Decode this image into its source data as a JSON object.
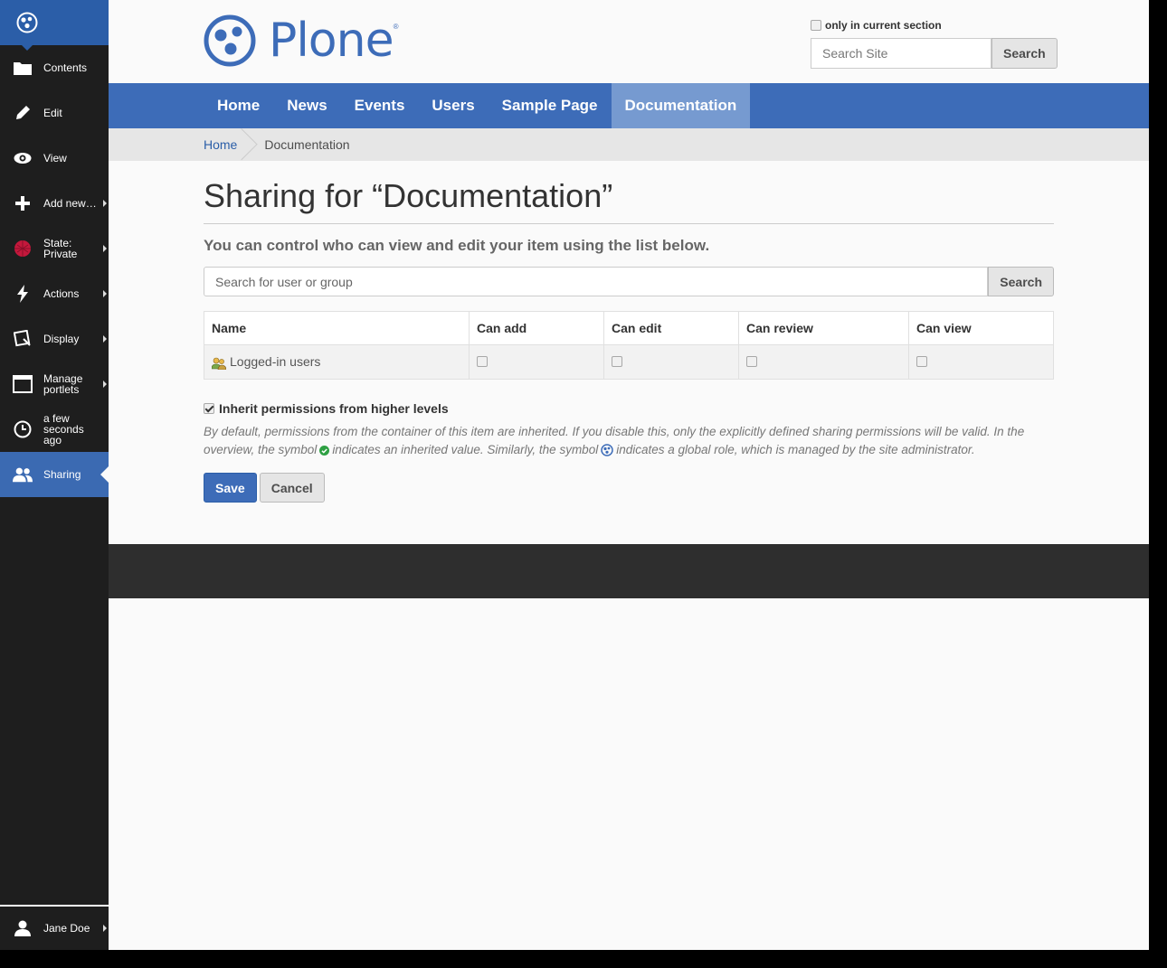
{
  "toolbar": {
    "items": [
      {
        "label": "Contents",
        "icon": "folder-icon"
      },
      {
        "label": "Edit",
        "icon": "pencil-icon"
      },
      {
        "label": "View",
        "icon": "eye-icon"
      },
      {
        "label": "Add new…",
        "icon": "plus-icon"
      },
      {
        "label": "State:\nPrivate",
        "icon": "state-icon"
      },
      {
        "label": "Actions",
        "icon": "lightning-icon"
      },
      {
        "label": "Display",
        "icon": "display-icon"
      },
      {
        "label": "Manage\nportlets",
        "icon": "portlets-icon"
      },
      {
        "label": "a few\nseconds\nago",
        "icon": "clock-icon"
      },
      {
        "label": "Sharing",
        "icon": "users-icon"
      }
    ],
    "user": "Jane Doe"
  },
  "header": {
    "logo_text": "Plone",
    "logo_reg": "®",
    "only_current_section": "only in current section",
    "search_placeholder": "Search Site",
    "search_button": "Search"
  },
  "nav": {
    "items": [
      "Home",
      "News",
      "Events",
      "Users",
      "Sample Page",
      "Documentation"
    ]
  },
  "breadcrumb": {
    "home": "Home",
    "current": "Documentation"
  },
  "page": {
    "title": "Sharing for “Documentation”",
    "lead": "You can control who can view and edit your item using the list below.",
    "user_search_placeholder": "Search for user or group",
    "user_search_button": "Search",
    "table": {
      "headers": [
        "Name",
        "Can add",
        "Can edit",
        "Can review",
        "Can view"
      ],
      "rows": [
        {
          "name": "Logged-in users"
        }
      ]
    },
    "inherit_label": "Inherit permissions from higher levels",
    "help_part1": "By default, permissions from the container of this item are inherited. If you disable this, only the explicitly defined sharing permissions will be valid. In the overview, the symbol",
    "help_part2": "indicates an inherited value. Similarly, the symbol",
    "help_part3": "indicates a global role, which is managed by the site administrator.",
    "save_button": "Save",
    "cancel_button": "Cancel"
  },
  "colors": {
    "brand": "#3d6cb8",
    "toolbar_bg": "#1e1e1e",
    "footer_bg": "#2e2e2e"
  }
}
